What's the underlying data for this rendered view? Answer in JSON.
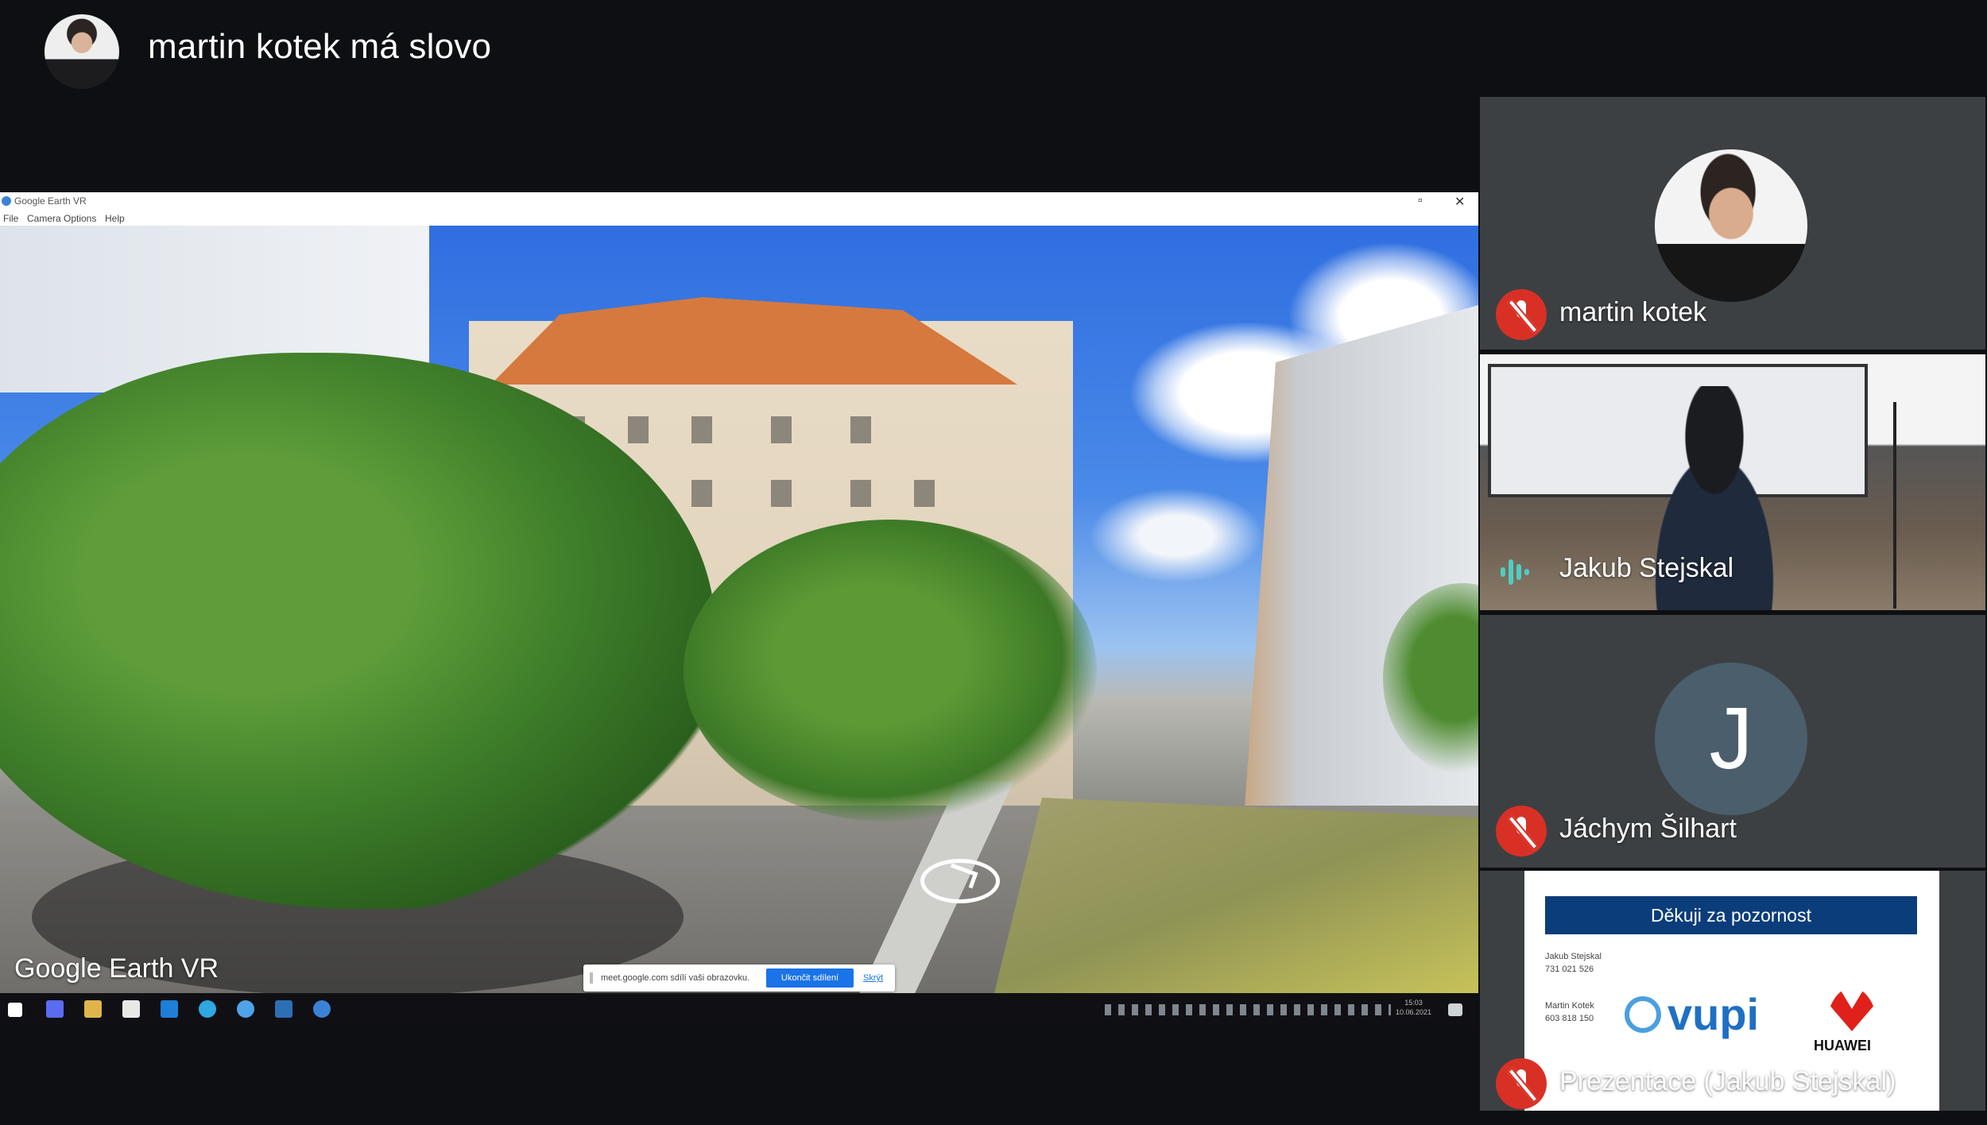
{
  "header": {
    "speaker_title": "martin kotek má slovo"
  },
  "shared_window": {
    "title": "Google Earth VR",
    "menu": [
      "File",
      "Camera",
      "Options",
      "Help"
    ],
    "logo_text": "Google Earth VR",
    "share_bar": {
      "message": "meet.google.com sdílí vaši obrazovku.",
      "stop_label": "Ukončit sdílení",
      "hide_label": "Skrýt"
    },
    "tray_clock": [
      "15:03",
      "10.06.2021"
    ]
  },
  "participants": [
    {
      "name": "martin kotek",
      "mic": "muted"
    },
    {
      "name": "Jakub Stejskal",
      "mic": "speaking"
    },
    {
      "name": "Jáchym Šilhart",
      "mic": "muted",
      "initial": "J"
    },
    {
      "name": "Prezentace (Jakub Stejskal)",
      "mic": "muted"
    }
  ],
  "presentation_slide": {
    "header": "Děkuji za pozornost",
    "contact1": [
      "Jakub Stejskal",
      "731 021 526"
    ],
    "contact2": [
      "Martin Kotek",
      "603 818 150"
    ],
    "vupi": "vupi",
    "huawei": "HUAWEI"
  },
  "colors": {
    "background": "#0e0f12",
    "tile": "#3c4043",
    "muted_red": "#d93025",
    "speaking": "#4ecdc4",
    "slide_header": "#0b3d7a"
  }
}
